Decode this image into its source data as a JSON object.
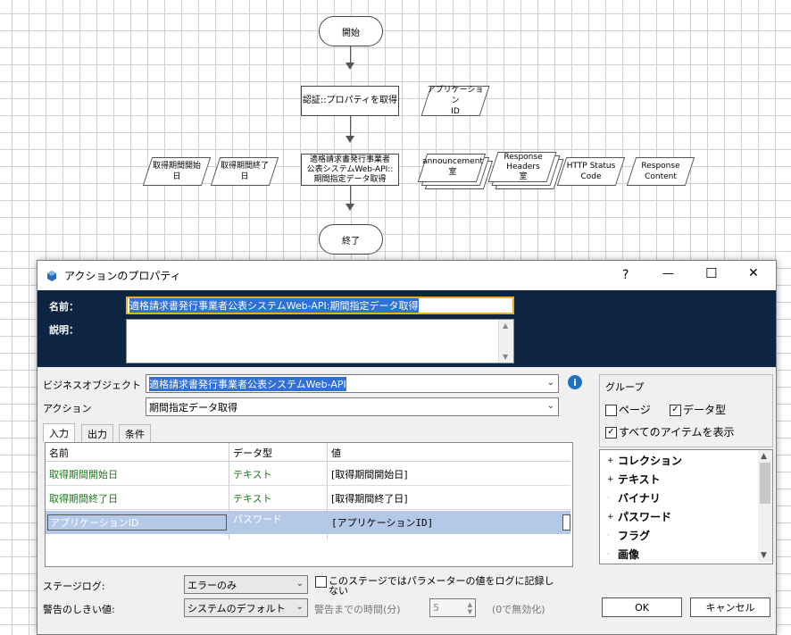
{
  "flow": {
    "start": "開始",
    "auth": "認証::プロパティを取得",
    "app_id": "アプリケーション\nID",
    "period_start": "取得期間開始\n日",
    "period_end": "取得期間終了\n日",
    "main": "適格請求書発行事業者\n公表システムWeb-API::\n期間指定データ取得",
    "announcement": "announcement\n室",
    "response_headers": "Response\nHeaders\n室",
    "http_status": "HTTP Status\nCode",
    "response_content": "Response\nContent",
    "end": "終了"
  },
  "dialog": {
    "title": "アクションのプロパティ",
    "help": "?",
    "minimize": "—",
    "maximize": "☐",
    "close": "✕",
    "name_label": "名前：",
    "name_value": "適格請求書発行事業者公表システムWeb-API:期間指定データ取得",
    "desc_label": "説明：",
    "bo_label": "ビジネスオブジェクト",
    "bo_value": "適格請求書発行事業者公表システムWeb-API",
    "action_label": "アクション",
    "action_value": "期間指定データ取得",
    "tabs": [
      "入力",
      "出力",
      "条件"
    ],
    "columns": [
      "名前",
      "データ型",
      "値"
    ],
    "rows": [
      {
        "name": "取得期間開始日",
        "type": "テキスト",
        "value": "[取得期間開始日]"
      },
      {
        "name": "取得期間終了日",
        "type": "テキスト",
        "value": "[取得期間終了日]"
      },
      {
        "name": "アプリケーションID",
        "type": "パスワード",
        "value": "[アプリケーションID]"
      }
    ],
    "group_label": "グループ",
    "page_label": "ページ",
    "datatype_label": "データ型",
    "showall_label": "すべてのアイテムを表示",
    "tree_items": [
      {
        "label": "コレクション",
        "expand": "+"
      },
      {
        "label": "テキスト",
        "expand": "+"
      },
      {
        "label": "バイナリ",
        "expand": ""
      },
      {
        "label": "パスワード",
        "expand": "+"
      },
      {
        "label": "フラグ",
        "expand": ""
      },
      {
        "label": "画像",
        "expand": ""
      }
    ],
    "stagelog_label": "ステージログ:",
    "stagelog_value": "エラーのみ",
    "nolog_label": "このステージではパラメーターの値をログに記録しない",
    "warn_label": "警告のしきい値:",
    "warn_value": "システムのデフォルト",
    "warn_time_label": "警告までの時間(分)",
    "warn_time_value": "5",
    "disable_note": "(0で無効化)",
    "ok": "OK",
    "cancel": "キャンセル"
  }
}
